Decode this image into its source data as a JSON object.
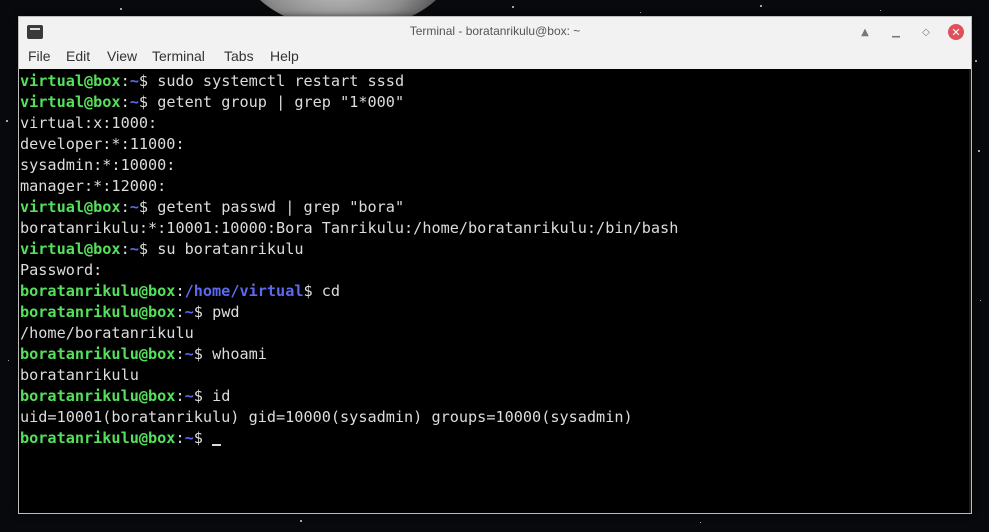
{
  "window": {
    "title": "Terminal - boratanrikulu@box: ~"
  },
  "menu": [
    "File",
    "Edit",
    "View",
    "Terminal",
    "Tabs",
    "Help"
  ],
  "controls": {
    "shade_glyph": "▲",
    "minimize_glyph": "▁",
    "maximize_glyph": "◇",
    "close_glyph": "✕"
  },
  "terminal": {
    "lines": [
      {
        "user": "virtual@box",
        "path": "~",
        "cmd": "sudo systemctl restart sssd"
      },
      {
        "user": "virtual@box",
        "path": "~",
        "cmd": "getent group | grep \"1*000\""
      },
      {
        "text": "virtual:x:1000:"
      },
      {
        "text": "developer:*:11000:"
      },
      {
        "text": "sysadmin:*:10000:"
      },
      {
        "text": "manager:*:12000:"
      },
      {
        "user": "virtual@box",
        "path": "~",
        "cmd": "getent passwd | grep \"bora\""
      },
      {
        "text": "boratanrikulu:*:10001:10000:Bora Tanrikulu:/home/boratanrikulu:/bin/bash"
      },
      {
        "user": "virtual@box",
        "path": "~",
        "cmd": "su boratanrikulu"
      },
      {
        "text": "Password:"
      },
      {
        "user": "boratanrikulu@box",
        "path": "/home/virtual",
        "cmd": "cd"
      },
      {
        "user": "boratanrikulu@box",
        "path": "~",
        "cmd": "pwd"
      },
      {
        "text": "/home/boratanrikulu"
      },
      {
        "user": "boratanrikulu@box",
        "path": "~",
        "cmd": "whoami"
      },
      {
        "text": "boratanrikulu"
      },
      {
        "user": "boratanrikulu@box",
        "path": "~",
        "cmd": "id"
      },
      {
        "text": "uid=10001(boratanrikulu) gid=10000(sysadmin) groups=10000(sysadmin)"
      },
      {
        "user": "boratanrikulu@box",
        "path": "~",
        "cmd": "",
        "cursor": true
      }
    ]
  },
  "colors": {
    "prompt_user": "#54e05a",
    "prompt_path": "#5b6af0",
    "terminal_bg": "#000000",
    "terminal_fg": "#dcdcdc",
    "close_button": "#e0505a"
  }
}
